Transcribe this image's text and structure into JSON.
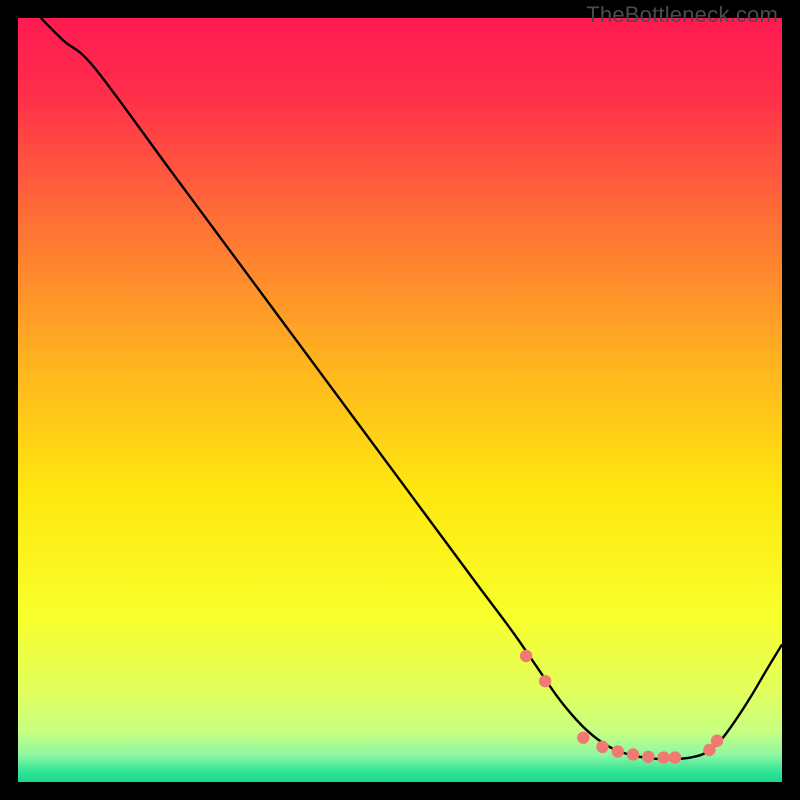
{
  "watermark": "TheBottleneck.com",
  "chart_data": {
    "type": "line",
    "title": "",
    "xlabel": "",
    "ylabel": "",
    "xlim": [
      0,
      100
    ],
    "ylim": [
      0,
      100
    ],
    "grid": false,
    "series": [
      {
        "name": "curve",
        "x": [
          3,
          6,
          10,
          20,
          30,
          40,
          50,
          60,
          65,
          70,
          72,
          74,
          76,
          78,
          80,
          82,
          84,
          86,
          88,
          90,
          92,
          94,
          96,
          98,
          100
        ],
        "y": [
          100,
          97,
          93.5,
          80,
          66.5,
          53,
          39.5,
          26,
          19.3,
          12,
          9.4,
          7.2,
          5.5,
          4.3,
          3.6,
          3.2,
          3.0,
          3.0,
          3.2,
          3.8,
          5.5,
          8.2,
          11.3,
          14.7,
          18
        ]
      }
    ],
    "markers": {
      "name": "dots",
      "x": [
        66.5,
        69,
        74,
        76.5,
        78.5,
        80.5,
        82.5,
        84.5,
        86,
        90.5,
        91.5
      ],
      "y": [
        16.5,
        13.2,
        5.8,
        4.6,
        4.0,
        3.6,
        3.3,
        3.2,
        3.2,
        4.2,
        5.4
      ]
    },
    "gradient_stops": [
      {
        "offset": 0.0,
        "color": "#ff1a52"
      },
      {
        "offset": 0.1,
        "color": "#ff2e4a"
      },
      {
        "offset": 0.25,
        "color": "#ff6a38"
      },
      {
        "offset": 0.45,
        "color": "#ffb31f"
      },
      {
        "offset": 0.62,
        "color": "#ffe70f"
      },
      {
        "offset": 0.78,
        "color": "#f8ff2a"
      },
      {
        "offset": 0.88,
        "color": "#e2ff5c"
      },
      {
        "offset": 0.935,
        "color": "#c6ff82"
      },
      {
        "offset": 0.965,
        "color": "#8cf7a2"
      },
      {
        "offset": 0.985,
        "color": "#35e596"
      },
      {
        "offset": 1.0,
        "color": "#17d98c"
      }
    ]
  }
}
